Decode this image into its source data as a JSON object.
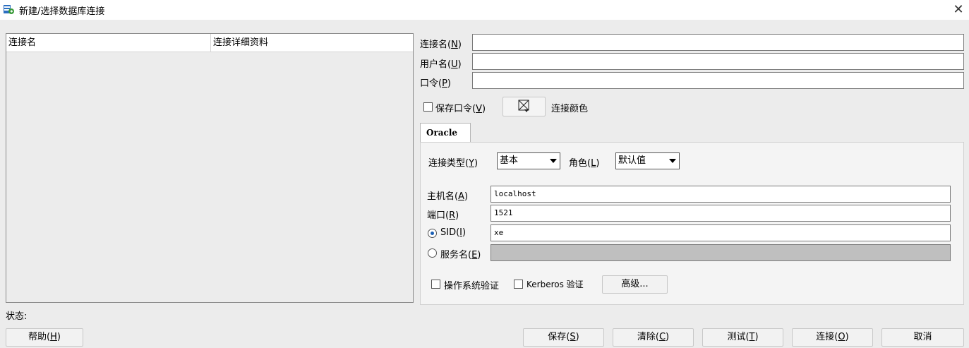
{
  "window": {
    "title": "新建/选择数据库连接",
    "close_glyph": "✕"
  },
  "connection_list": {
    "columns": [
      "连接名",
      "连接详细资料"
    ]
  },
  "form": {
    "conn_name_label": "连接名(N)",
    "conn_name_value": "",
    "username_label": "用户名(U)",
    "username_value": "",
    "password_label": "口令(P)",
    "password_value": "",
    "save_password_label": "保存口令(V)",
    "save_password_checked": false,
    "connection_color_label": "连接颜色"
  },
  "oracle_tab": {
    "tab_label": "Oracle",
    "conn_type_label": "连接类型(Y)",
    "conn_type_value": "基本",
    "role_label": "角色(L)",
    "role_value": "默认值",
    "hostname_label": "主机名(A)",
    "hostname_value": "localhost",
    "port_label": "端口(R)",
    "port_value": "1521",
    "sid_label": "SID(I)",
    "sid_value": "xe",
    "sid_selected": true,
    "service_label": "服务名(E)",
    "service_value": "",
    "os_auth_label": "操作系统验证",
    "kerberos_label": "Kerberos 验证",
    "advanced_label": "高级..."
  },
  "status": {
    "label": "状态:"
  },
  "buttons": {
    "help": "帮助(H)",
    "save": "保存(S)",
    "clear": "清除(C)",
    "test": "测试(T)",
    "connect": "连接(O)",
    "cancel": "取消"
  },
  "colors": {
    "window_bg": "#ececec",
    "accent_radio": "#1a5fb4",
    "app_icon_green": "#3a9a3a",
    "app_icon_blue": "#2c6fc1"
  }
}
